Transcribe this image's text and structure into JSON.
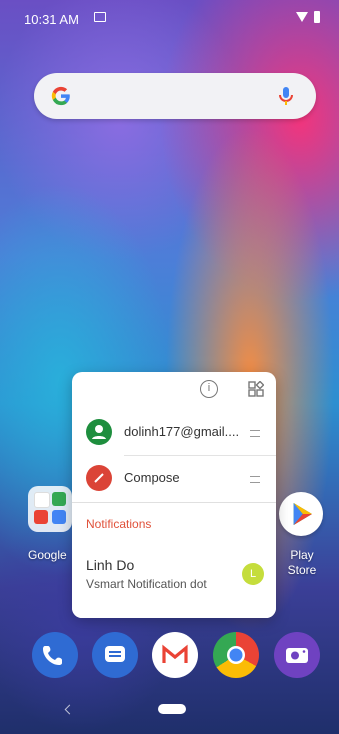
{
  "status": {
    "time": "10:31 AM"
  },
  "search": {},
  "popup": {
    "shortcuts": [
      {
        "label": "dolinh177@gmail...."
      },
      {
        "label": "Compose"
      }
    ],
    "notifications": {
      "title": "Notifications",
      "name": "Linh Do",
      "body": "Vsmart Notification dot",
      "avatar_letter": "L"
    }
  },
  "apps": {
    "left_label": "Google",
    "play_label_line1": "Play",
    "play_label_line2": "Store"
  },
  "colors": {
    "google_blue": "#4285F4",
    "google_red": "#EA4335",
    "google_yellow": "#FBBC05",
    "google_green": "#34A853",
    "account_green": "#1e8e3e",
    "compose_red": "#db4437",
    "notif_title": "#e0513a"
  },
  "icons": [
    "notification-icon",
    "wifi-icon",
    "battery-icon",
    "google-g-icon",
    "mic-icon",
    "info-icon",
    "widgets-icon",
    "account-icon",
    "compose-icon",
    "drag-handle-icon",
    "play-store-icon",
    "phone-icon",
    "messages-icon",
    "gmail-icon",
    "chrome-icon",
    "camera-icon",
    "back-icon",
    "home-icon"
  ]
}
